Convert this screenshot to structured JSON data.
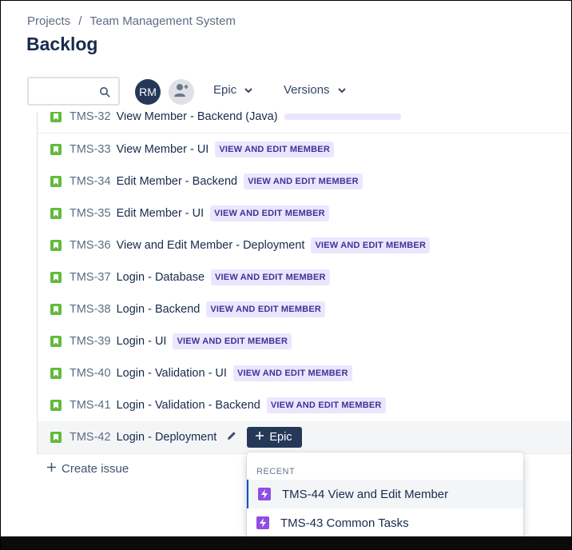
{
  "breadcrumb": {
    "projects": "Projects",
    "separator": "/",
    "project": "Team Management System"
  },
  "page_title": "Backlog",
  "toolbar": {
    "search_placeholder": "",
    "avatar_initials": "RM",
    "epic_filter": "Epic",
    "versions_filter": "Versions"
  },
  "partial_row": {
    "key": "TMS-32",
    "summary": "View Member - Backend (Java)"
  },
  "issues": [
    {
      "key": "TMS-33",
      "summary": "View Member - UI",
      "epic": "VIEW AND EDIT MEMBER"
    },
    {
      "key": "TMS-34",
      "summary": "Edit Member - Backend",
      "epic": "VIEW AND EDIT MEMBER"
    },
    {
      "key": "TMS-35",
      "summary": "Edit Member - UI",
      "epic": "VIEW AND EDIT MEMBER"
    },
    {
      "key": "TMS-36",
      "summary": "View and Edit Member - Deployment",
      "epic": "VIEW AND EDIT MEMBER"
    },
    {
      "key": "TMS-37",
      "summary": "Login - Database",
      "epic": "VIEW AND EDIT MEMBER"
    },
    {
      "key": "TMS-38",
      "summary": "Login - Backend",
      "epic": "VIEW AND EDIT MEMBER"
    },
    {
      "key": "TMS-39",
      "summary": "Login - UI",
      "epic": "VIEW AND EDIT MEMBER"
    },
    {
      "key": "TMS-40",
      "summary": "Login - Validation - UI",
      "epic": "VIEW AND EDIT MEMBER"
    },
    {
      "key": "TMS-41",
      "summary": "Login - Validation - Backend",
      "epic": "VIEW AND EDIT MEMBER"
    }
  ],
  "active_issue": {
    "key": "TMS-42",
    "summary": "Login - Deployment",
    "epic_button": "Epic"
  },
  "create_issue": "Create issue",
  "epic_dropdown": {
    "heading": "RECENT",
    "items": [
      {
        "label": "TMS-44 View and Edit Member"
      },
      {
        "label": "TMS-43 Common Tasks"
      }
    ]
  },
  "colors": {
    "story": "#63ba3c",
    "epic": "#904ee2",
    "lozenge_bg": "#eae6ff",
    "lozenge_text": "#403294",
    "accent": "#0052cc"
  }
}
